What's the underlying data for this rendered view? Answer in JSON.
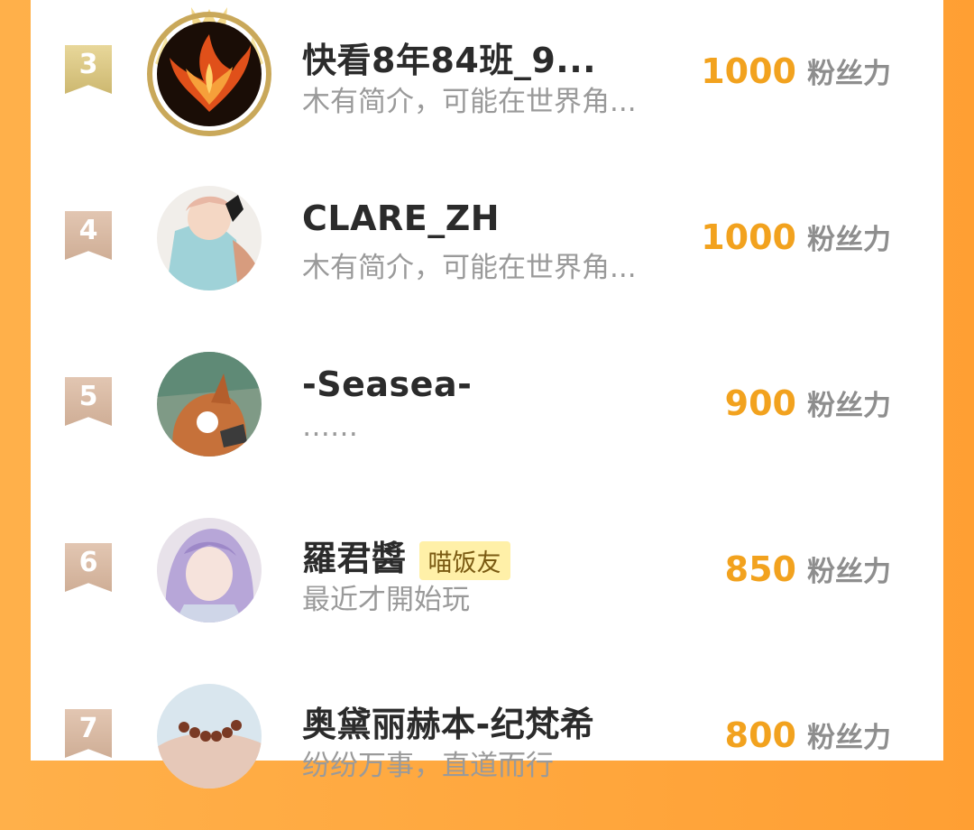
{
  "rows": [
    {
      "rank": "3",
      "name": "快看8年84班_9...",
      "bio": "木有简介，可能在世界角...",
      "score": "1000",
      "unit": "粉丝力"
    },
    {
      "rank": "4",
      "name": "CLARE_ZH",
      "bio": "木有简介，可能在世界角...",
      "score": "1000",
      "unit": "粉丝力"
    },
    {
      "rank": "5",
      "name": "-Seasea-",
      "bio": "……",
      "score": "900",
      "unit": "粉丝力"
    },
    {
      "rank": "6",
      "name": "羅君醬",
      "tag": "喵饭友",
      "bio": "最近才開始玩",
      "score": "850",
      "unit": "粉丝力"
    },
    {
      "rank": "7",
      "name": "奥黛丽赫本-纪梵希",
      "bio": "纷纷万事，直道而行",
      "score": "800",
      "unit": "粉丝力"
    }
  ],
  "colors": {
    "background_orange": "#ffa83f",
    "score_orange": "#f2a21e",
    "badge_gold": "#d9c47e",
    "badge_tan": "#d8b9a3",
    "tag_yellow": "#fff0a8"
  }
}
